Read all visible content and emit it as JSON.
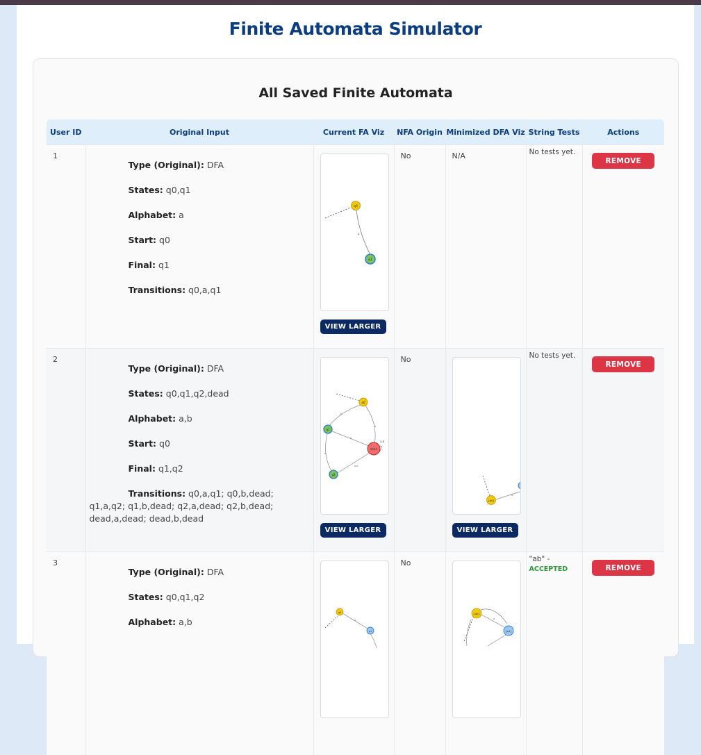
{
  "app": {
    "title": "Finite Automata Simulator"
  },
  "section": {
    "title": "All Saved Finite Automata"
  },
  "table": {
    "headers": [
      "User ID",
      "Original Input",
      "Current FA Viz",
      "NFA Origin",
      "Minimized DFA Viz",
      "String Tests",
      "Actions"
    ],
    "labels": {
      "type": "Type (Original):",
      "states": "States:",
      "alphabet": "Alphabet:",
      "start": "Start:",
      "final": "Final:",
      "transitions": "Transitions:"
    },
    "view_larger": "VIEW LARGER",
    "remove": "REMOVE",
    "rows": [
      {
        "id": "1",
        "type": "DFA",
        "states": "q0,q1",
        "alphabet": "a",
        "start": "q0",
        "final": "q1",
        "transitions": "q0,a,q1",
        "nfa_origin": "No",
        "minimized": "N/A",
        "tests": "No tests yet."
      },
      {
        "id": "2",
        "type": "DFA",
        "states": "q0,q1,q2,dead",
        "alphabet": "a,b",
        "start": "q0",
        "final": "q1,q2",
        "transitions": "q0,a,q1; q0,b,dead; q1,a,q2; q1,b,dead; q2,a,dead; q2,b,dead; dead,a,dead; dead,b,dead",
        "nfa_origin": "No",
        "minimized": "",
        "tests": "No tests yet."
      },
      {
        "id": "3",
        "type": "DFA",
        "states": "q0,q1,q2",
        "alphabet": "a,b",
        "start": "",
        "final": "",
        "transitions": "",
        "nfa_origin": "No",
        "minimized": "",
        "tests": "\"ab\" -",
        "test_result": "ACCEPTED"
      }
    ]
  },
  "graph_labels": {
    "q0": "q0",
    "q1": "q1",
    "q2": "q2",
    "dead": "dead",
    "a": "a",
    "b": "b",
    "ab": "a,b",
    "min_s0": "{q0}",
    "min_s1": "{q1}"
  },
  "colors": {
    "title": "#0b3d80",
    "start_state": "#f2c80f",
    "final_state": "#7cc35a",
    "final_ring": "#2a7fd4",
    "dead_state": "#f26b6b",
    "remove_button": "#dc3545",
    "view_button": "#0b2a63",
    "accepted": "#2a9a3a"
  }
}
